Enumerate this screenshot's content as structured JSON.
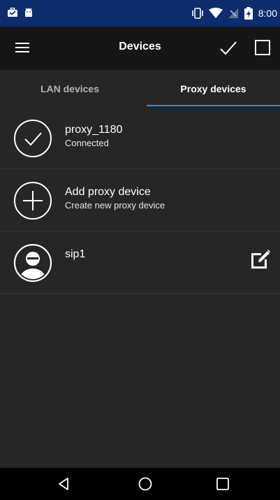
{
  "status_bar": {
    "time": "8:00",
    "icons": [
      "briefcase-icon",
      "android-icon",
      "vibrate-icon",
      "wifi-icon",
      "no-signal-icon",
      "battery-icon"
    ]
  },
  "app_bar": {
    "title": "Devices",
    "menu_icon": "hamburger-menu-icon",
    "check_icon": "check-icon",
    "select_icon": "checkbox-square-icon"
  },
  "tabs": [
    {
      "label": "LAN devices",
      "selected": false
    },
    {
      "label": "Proxy devices",
      "selected": true
    }
  ],
  "colors": {
    "status_bar": "#0d2c6b",
    "app_bar": "#161616",
    "background": "#262626",
    "tab_indicator": "#2d8fd6"
  },
  "devices": [
    {
      "title": "proxy_1180",
      "subtitle": "Connected",
      "icon": "check-circle-icon"
    },
    {
      "title": "Add proxy device",
      "subtitle": "Create new proxy device",
      "icon": "plus-circle-icon"
    },
    {
      "title": "sip1",
      "subtitle": "",
      "icon": "user-avatar-icon",
      "action_icon": "edit-icon"
    }
  ],
  "nav_bar": {
    "back_icon": "back-triangle-icon",
    "home_icon": "home-circle-icon",
    "recent_icon": "recent-apps-square-icon"
  }
}
